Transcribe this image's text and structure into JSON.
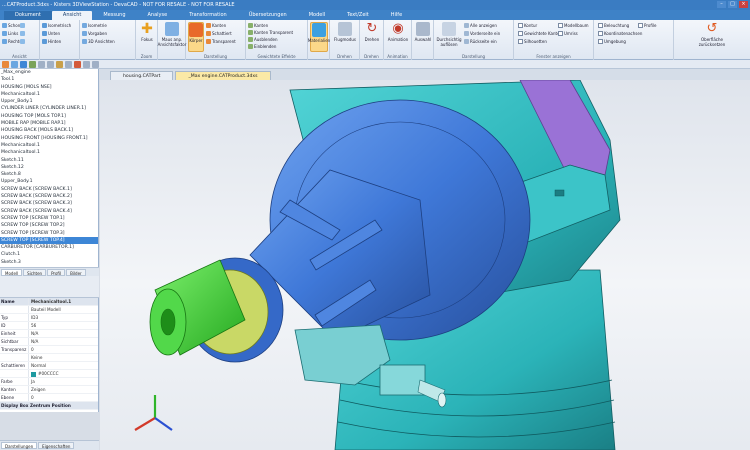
{
  "window": {
    "title": "...CATProduct.3dxs - Kisters 3DViewStation - DevaCAD - NOT FOR RESALE - NOT FOR RESALE",
    "min": "–",
    "max": "□",
    "close": "×"
  },
  "ribbon": {
    "tabs": [
      "Dokument",
      "Ansicht",
      "Messung",
      "Analyse",
      "Transformation",
      "Übersetzungen",
      "Modell",
      "Text/Zeit",
      "Hilfe"
    ],
    "active_tab": "Ansicht",
    "groups": {
      "g1": {
        "items": [
          "Schon",
          "Links",
          "Rechts"
        ],
        "label": "Ansicht"
      },
      "g2": {
        "items": [
          "Isometrisch",
          "Unten",
          "Hinten"
        ],
        "label": ""
      },
      "g3": {
        "items": [
          "Isometrie",
          "Vorgaben",
          "3D Ansichten"
        ],
        "label": ""
      },
      "g4": {
        "big": "Fokus",
        "label": "Zoom"
      },
      "g5": {
        "big": "Maus anp. Ansichtsfaktor",
        "label": ""
      },
      "g6": {
        "big": "Körper",
        "items": [
          "Kanten",
          "Schattiert",
          "Transparent"
        ],
        "label": "Darstellung"
      },
      "g7": {
        "items": [
          "Kanten",
          "Kanten Transparent",
          "Ausblenden",
          "Einblenden"
        ],
        "label": "Gewichtete Effekte"
      },
      "g8": {
        "big": "Materialien",
        "label": ""
      },
      "g9": {
        "big": "Flugmodus",
        "label": "Drehen"
      },
      "g10": {
        "big": "Drehen",
        "label": "Drehen"
      },
      "g11": {
        "big": "Animation",
        "label": "Animation"
      },
      "g12": {
        "big": "Auswahl",
        "label": ""
      },
      "g13": {
        "big": "Durchsichtig auflösen",
        "items": [
          "Alle anzeigen",
          "Vorderseite ein",
          "Rückseite ein"
        ],
        "label": "Darstellung"
      },
      "g14": {
        "items": [
          "Kontur",
          "Gewichtete Kanten",
          "Silhouetten",
          "Modellbaum",
          "Umriss"
        ],
        "label": "Fenster anzeigen"
      },
      "g15": {
        "items": [
          "Beleuchtung",
          "Koordinatenachsen",
          "Umgebung",
          "Profile"
        ],
        "label": ""
      },
      "g16": {
        "big": "Oberfläche zurücksetzen",
        "label": ""
      }
    }
  },
  "tree": {
    "items": [
      "_Max_engine",
      "Tool.1",
      "HOUSING [MOLS NSE]",
      "Mechanicaltool.1",
      "Upper_Body.1",
      "CYLINDER LINER [CYLINDER LINER.1]",
      "HOUSING TOP [MOLS TOP.1]",
      "MOBILE RAP [MOBILE RAP.1]",
      "HOUSING BACK [MOLS BACK.1]",
      "HOUSING FRONT [HOUSING FRONT.1]",
      "Mechanicaltool.1",
      "Mechanicaltool.1",
      "Sketch.11",
      "Sketch.12",
      "Sketch.8",
      "Upper_Body.1",
      "SCREW BACK [SCREW BACK.1]",
      "SCREW BACK [SCREW BACK.2]",
      "SCREW BACK [SCREW BACK.3]",
      "SCREW BACK [SCREW BACK.4]",
      "SCREW TOP [SCREW TOP.1]",
      "SCREW TOP [SCREW TOP.2]",
      "SCREW TOP [SCREW TOP.3]",
      "SCREW TOP [SCREW TOP.4]",
      "CARBURETOR [CARBURETOR.1]",
      "Clutch.1",
      "Sketch.3"
    ],
    "selected_index": 23
  },
  "panel_tabs": [
    "Modell",
    "Sichten",
    "Profil",
    "Bilder"
  ],
  "properties": {
    "rows": [
      {
        "k": "Name",
        "v": "Mechanicaltool.1",
        "section": true
      },
      {
        "k": "",
        "v": "Bauteil Modell"
      },
      {
        "k": "Typ",
        "v": "ID3"
      },
      {
        "k": "ID",
        "v": "56"
      },
      {
        "k": "Einheit",
        "v": "N/A"
      },
      {
        "k": "Sichtbar",
        "v": "N/A"
      },
      {
        "k": "Transparenz",
        "v": "0"
      },
      {
        "k": "",
        "v": "Keine"
      },
      {
        "k": "Schattieren",
        "v": "Normal"
      },
      {
        "k": "",
        "v": "#00CCCC",
        "swatch": true
      },
      {
        "k": "Farbe",
        "v": "Ja"
      },
      {
        "k": "Kanten",
        "v": "Zeigen"
      },
      {
        "k": "Ebene",
        "v": "0"
      },
      {
        "k": "Display Box Zentrum Position",
        "v": "",
        "section": true
      }
    ]
  },
  "bottom_tabs": [
    "Darstellungen",
    "Eigenschaften"
  ],
  "document_tabs": [
    "housing.CATPart",
    "_Max engine.CATProduct.3dxs"
  ],
  "active_document_tab": 1,
  "colors": {
    "ribbon_blue": "#3e82c7",
    "model_cyan": "#2bb3b8",
    "model_blue": "#3f78d8",
    "model_green": "#3dd13a",
    "model_purple": "#9a72d6",
    "selection_blue": "#3d86d6"
  },
  "icons": [
    "view-cube-icon",
    "focus-icon",
    "body-icon",
    "material-icon",
    "fly-icon",
    "rotate-icon",
    "animation-icon",
    "reset-ui-icon"
  ]
}
